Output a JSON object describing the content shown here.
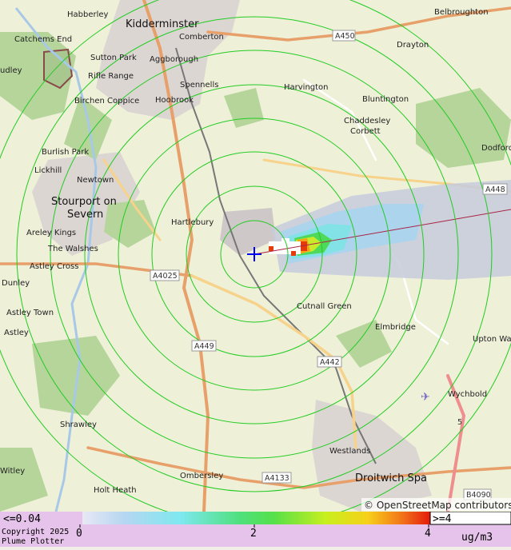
{
  "places": [
    {
      "name": "Kidderminster",
      "big": true
    },
    {
      "name": "Habberley"
    },
    {
      "name": "Catchems End"
    },
    {
      "name": "udley"
    },
    {
      "name": "Sutton Park"
    },
    {
      "name": "Aggborough"
    },
    {
      "name": "Comberton"
    },
    {
      "name": "Rifle Range"
    },
    {
      "name": "Spennells"
    },
    {
      "name": "Birchen Coppice"
    },
    {
      "name": "Hoobrook"
    },
    {
      "name": "Harvington"
    },
    {
      "name": "Drayton"
    },
    {
      "name": "Belbroughton"
    },
    {
      "name": "Bluntington"
    },
    {
      "name": "Chaddesley"
    },
    {
      "name": "Corbett"
    },
    {
      "name": "Burlish Park"
    },
    {
      "name": "Lickhill"
    },
    {
      "name": "Newtown"
    },
    {
      "name": "Dodford"
    },
    {
      "name": "Stourport on",
      "big": true
    },
    {
      "name": "Severn",
      "big": true
    },
    {
      "name": "Hartlebury"
    },
    {
      "name": "Areley Kings"
    },
    {
      "name": "The Walshes"
    },
    {
      "name": "Astley Cross"
    },
    {
      "name": "Dunley"
    },
    {
      "name": "Astley Town"
    },
    {
      "name": "Astley"
    },
    {
      "name": "Cutnall Green"
    },
    {
      "name": "Elmbridge"
    },
    {
      "name": "Upton Wa"
    },
    {
      "name": "Wychbold"
    },
    {
      "name": "Shrawley"
    },
    {
      "name": "Westlands"
    },
    {
      "name": "Droitwich Spa",
      "big": true
    },
    {
      "name": "Ombersley"
    },
    {
      "name": "Holt Heath"
    },
    {
      "name": "Witley"
    }
  ],
  "roads": [
    "A450",
    "A448",
    "A4025",
    "A449",
    "A442",
    "A4133",
    "B4090",
    "5"
  ],
  "attribution": "© OpenStreetMap contributors",
  "legend": {
    "min_label": "<=0.04",
    "max_label": ">=4",
    "ticks": [
      "0",
      "2",
      "4"
    ],
    "unit": "ug/m3",
    "copyright_line1": "Copyright 2025",
    "copyright_line2": "Plume Plotter"
  },
  "colors": {
    "ring": "#22cc22",
    "source_marker": "#0000ff",
    "plume_direction_line": "#aa2244",
    "legend_bg": "#e6c3ea"
  },
  "icons": {
    "source": "plus-marker",
    "airfield": "plane-icon"
  }
}
